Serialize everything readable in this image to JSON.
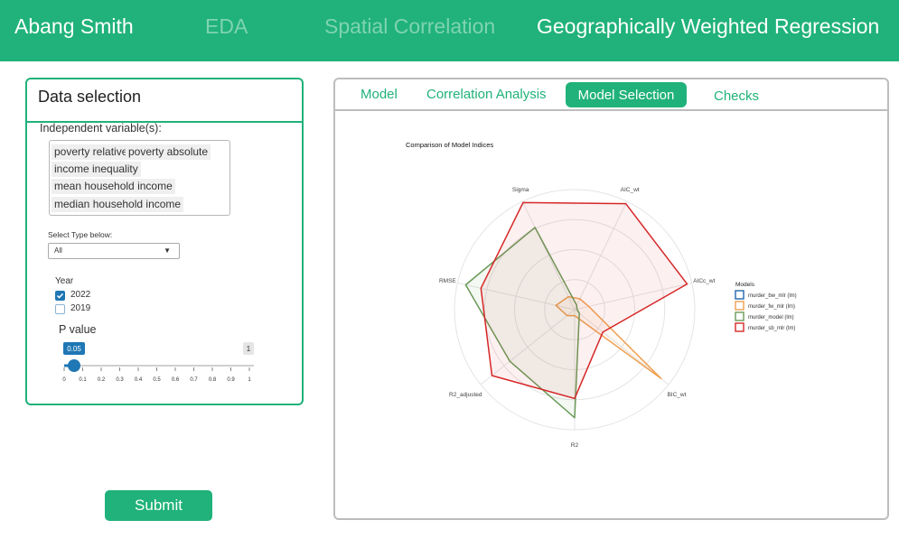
{
  "header": {
    "brand": "Abang Smith",
    "nav": [
      "EDA",
      "Spatial Correlation",
      "Geographically Weighted Regression"
    ]
  },
  "sidebar": {
    "title": "Data selection",
    "independent_label": "Independent variable(s):",
    "independent_selected": [
      "poverty relative",
      "poverty absolute",
      "income inequality",
      "mean household income",
      "median household income"
    ],
    "type_label": "Select Type below:",
    "type_value": "All",
    "year_label": "Year",
    "years": [
      {
        "label": "2022",
        "checked": true
      },
      {
        "label": "2019",
        "checked": false
      }
    ],
    "pvalue_label": "P value",
    "pvalue": 0.05,
    "pvalue_min_label": "0",
    "pvalue_max_label": "1",
    "pvalue_value_label": "0.05",
    "pvalue_max_badge": "1",
    "slider_ticks": [
      "0",
      "0.1",
      "0.2",
      "0.3",
      "0.4",
      "0.5",
      "0.6",
      "0.7",
      "0.8",
      "0.9",
      "1"
    ],
    "submit_label": "Submit"
  },
  "main": {
    "tabs": [
      "Model",
      "Correlation Analysis",
      "Model Selection",
      "Checks"
    ],
    "active_tab": "Model Selection"
  },
  "colors": {
    "brand": "#20b27a",
    "brand_faded": "#7fd3b2",
    "slider": "#1f77b4"
  },
  "chart_data": {
    "type": "radar",
    "title": "Comparison of Model Indices",
    "axes": [
      "AIC_wt",
      "AICc_wt",
      "BIC_wt",
      "R2",
      "R2_adjusted",
      "RMSE",
      "Sigma"
    ],
    "legend_title": "Models",
    "legend_position": "right",
    "range": [
      0,
      1
    ],
    "grid": true,
    "series": [
      {
        "name": "murder_bw_mlr (lm)",
        "color": "#2166ac",
        "values": [
          0.0,
          0.0,
          0.0,
          0.0,
          0.0,
          0.0,
          0.0
        ]
      },
      {
        "name": "murder_fw_mlr (lm)",
        "color": "#f0a050",
        "values": [
          0.1,
          0.12,
          0.92,
          0.05,
          0.08,
          0.16,
          0.12
        ]
      },
      {
        "name": "murder_model (lm)",
        "color": "#6a9a58",
        "values": [
          0.04,
          0.02,
          0.05,
          0.9,
          0.69,
          0.93,
          0.76
        ]
      },
      {
        "name": "murder_sb_mlr (lm)",
        "color": "#d62728",
        "values": [
          0.98,
          0.96,
          0.3,
          0.74,
          0.88,
          0.8,
          0.99
        ]
      }
    ]
  }
}
